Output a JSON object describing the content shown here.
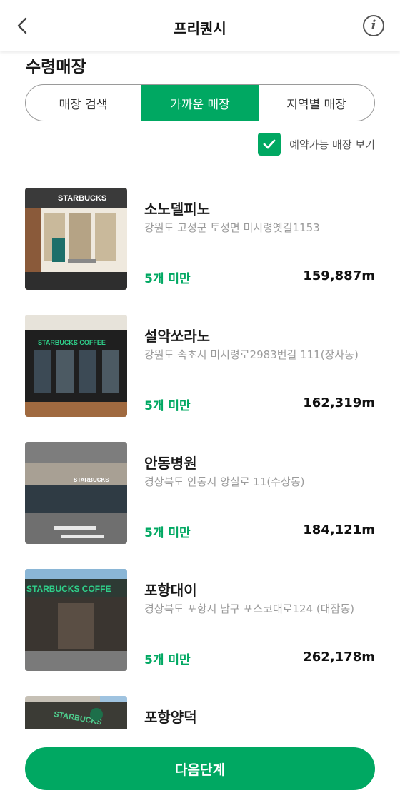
{
  "header": {
    "title": "프리퀀시"
  },
  "section_title": "수령매장",
  "tabs": [
    {
      "label": "매장 검색",
      "active": false
    },
    {
      "label": "가까운 매장",
      "active": true
    },
    {
      "label": "지역별 매장",
      "active": false
    }
  ],
  "filter": {
    "label": "예약가능 매장 보기",
    "checked": true
  },
  "stores": [
    {
      "name": "소노델피노",
      "address": "강원도 고성군 토성면 미시령옛길1153",
      "stock": "5개 미만",
      "distance": "159,887m",
      "sign": "STARBUCKS"
    },
    {
      "name": "설악쏘라노",
      "address": "강원도 속초시 미시령로2983번길 111(장사동)",
      "stock": "5개 미만",
      "distance": "162,319m",
      "sign": "STARBUCKS COFFEE"
    },
    {
      "name": "안동병원",
      "address": "경상북도 안동시 앙실로 11(수상동)",
      "stock": "5개 미만",
      "distance": "184,121m",
      "sign": "STARBUCKS"
    },
    {
      "name": "포항대이",
      "address": "경상북도 포항시 남구 포스코대로124 (대잠동)",
      "stock": "5개 미만",
      "distance": "262,178m",
      "sign": "STARBUCKS COFFE"
    },
    {
      "name": "포항양덕",
      "address": "",
      "stock": "",
      "distance": "",
      "sign": "STARBUCKS"
    }
  ],
  "footer": {
    "next_label": "다음단계"
  },
  "colors": {
    "accent": "#00a862",
    "text": "#1a1a1a",
    "muted": "#9b9b9b"
  }
}
